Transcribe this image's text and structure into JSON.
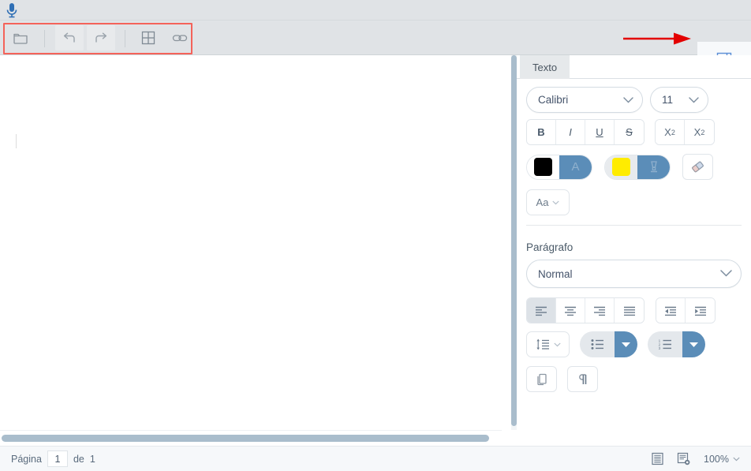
{
  "app": {
    "panel_divider_color": "#a9bdcc",
    "toolbar_bg": "#e0e3e6",
    "accent_blue": "#5b8db8",
    "annotation_color": "#f4635a"
  },
  "mic": {
    "icon": "microphone-icon",
    "color": "#2f6fb5"
  },
  "toolbar": {
    "items": [
      {
        "name": "open-folder-button",
        "icon": "folder-open-icon"
      },
      {
        "name": "undo-button",
        "icon": "undo-arrow-icon"
      },
      {
        "name": "redo-button",
        "icon": "redo-arrow-icon"
      },
      {
        "name": "insert-table-button",
        "icon": "table-grid-icon"
      },
      {
        "name": "insert-link-button",
        "icon": "chain-link-icon"
      }
    ],
    "sidebar_toggle": {
      "name": "sidebar-toggle-button",
      "icon": "panel-right-icon"
    }
  },
  "annotations": {
    "rect_label": "toolbar-highlight-rectangle",
    "arrow_label": "pointer-arrow-to-sidebar-toggle"
  },
  "document": {
    "caret_visible": true,
    "vertical_scrollbar": "document-vertical-scrollbar",
    "horizontal_scrollbar": "document-horizontal-scrollbar"
  },
  "panel": {
    "tabs": [
      {
        "label": "Texto",
        "active": true
      }
    ],
    "text_section": {
      "font": {
        "value": "Calibri",
        "placeholder": "Calibri"
      },
      "size": {
        "value": "11",
        "placeholder": "11"
      },
      "style_buttons": [
        {
          "label": "B",
          "name": "bold-button",
          "style": "b"
        },
        {
          "label": "I",
          "name": "italic-button",
          "style": "i"
        },
        {
          "label": "U",
          "name": "underline-button",
          "style": "u"
        },
        {
          "label": "S",
          "name": "strikethrough-button",
          "style": "s"
        }
      ],
      "script_buttons": [
        {
          "label": "X",
          "sup": "2",
          "name": "superscript-button"
        },
        {
          "label": "X",
          "sub": "2",
          "name": "subscript-button"
        }
      ],
      "font_color": {
        "name": "font-color-button",
        "swatch": "#000000",
        "glyph": "A"
      },
      "highlight_color": {
        "name": "highlight-color-button",
        "swatch": "#ffec00",
        "glyph": "highlighter-icon"
      },
      "clear_format": {
        "name": "clear-formatting-button",
        "icon": "eraser-icon"
      },
      "change_case": {
        "label": "Aa",
        "name": "change-case-button"
      }
    },
    "paragraph_section": {
      "title": "Parágrafo",
      "style": {
        "value": "Normal",
        "placeholder": "Normal"
      },
      "align_buttons": [
        {
          "name": "align-left-button",
          "icon": "align-left-icon",
          "active": true
        },
        {
          "name": "align-center-button",
          "icon": "align-center-icon",
          "active": false
        },
        {
          "name": "align-right-button",
          "icon": "align-right-icon",
          "active": false
        },
        {
          "name": "align-justify-button",
          "icon": "align-justify-icon",
          "active": false
        }
      ],
      "indent_buttons": [
        {
          "name": "decrease-indent-button",
          "icon": "indent-decrease-icon"
        },
        {
          "name": "increase-indent-button",
          "icon": "indent-increase-icon"
        }
      ],
      "line_spacing": {
        "name": "line-spacing-button",
        "icon": "line-spacing-icon"
      },
      "bullet_list": {
        "name": "bullet-list-button",
        "icon": "bullet-list-icon"
      },
      "numbered_list": {
        "name": "numbered-list-button",
        "icon": "numbered-list-icon"
      },
      "copy_format": {
        "name": "copy-format-button",
        "icon": "copy-pages-icon"
      },
      "show_marks": {
        "name": "show-formatting-marks-button",
        "icon": "pilcrow-icon"
      }
    }
  },
  "statusbar": {
    "page_label": "Página",
    "page_value": "1",
    "of_label": "de",
    "page_total": "1",
    "view_mode_print": "print-layout-icon",
    "view_mode_web": "web-layout-icon",
    "zoom": "100%"
  }
}
